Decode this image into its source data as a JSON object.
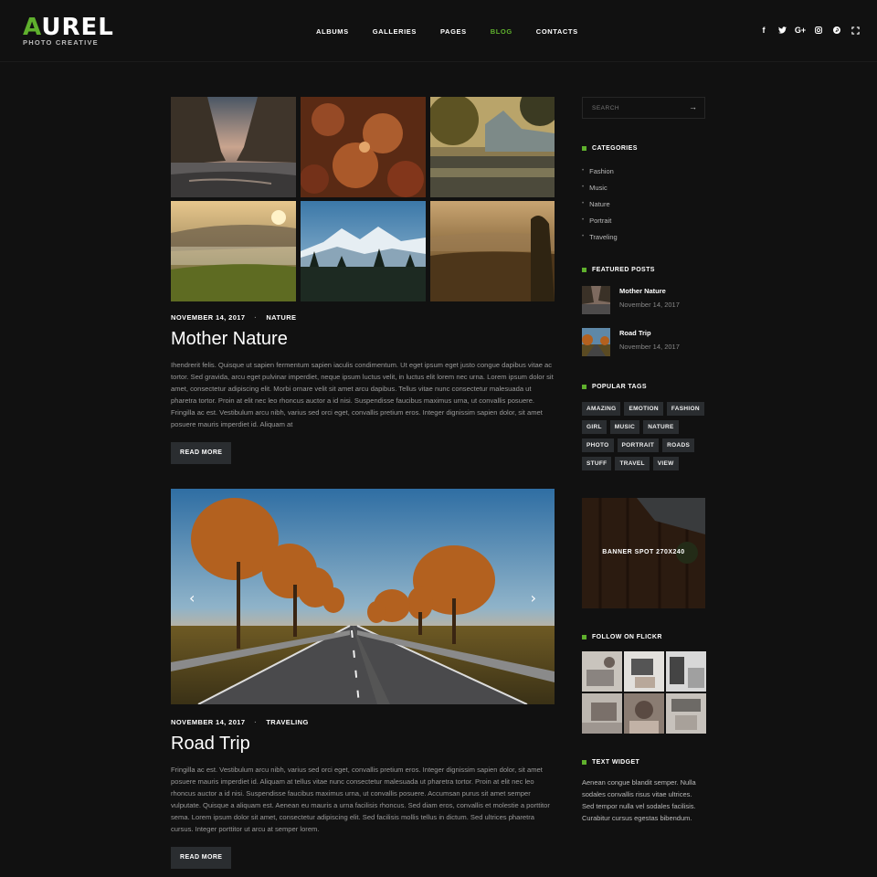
{
  "brand": {
    "logo_accent": "A",
    "logo_rest": "UREL",
    "tagline": "PHOTO CREATIVE",
    "accent_color": "#5fb02d"
  },
  "nav": {
    "items": [
      {
        "label": "ALBUMS"
      },
      {
        "label": "GALLERIES"
      },
      {
        "label": "PAGES"
      },
      {
        "label": "BLOG",
        "active": true
      },
      {
        "label": "CONTACTS"
      }
    ]
  },
  "social": [
    "facebook-icon",
    "twitter-icon",
    "google-plus-icon",
    "instagram-icon",
    "pinterest-icon",
    "fullscreen-icon"
  ],
  "social_labels": {
    "facebook": "f",
    "google": "G+"
  },
  "posts": [
    {
      "date": "NOVEMBER 14, 2017",
      "category": "NATURE",
      "title": "Mother Nature",
      "excerpt": "Ihendrerit felis. Quisque ut sapien fermentum sapien iaculis condimentum. Ut eget ipsum eget justo congue dapibus vitae ac tortor. Sed gravida, arcu eget pulvinar imperdiet, neque ipsum luctus velit, in luctus elit lorem nec urna. Lorem ipsum dolor sit amet, consectetur adipiscing elit. Morbi ornare velit sit amet arcu dapibus. Tellus vitae nunc consectetur malesuada ut pharetra tortor. Proin at elit nec leo rhoncus auctor a id nisi. Suspendisse faucibus maximus urna, ut convallis posuere. Fringilla ac est. Vestibulum arcu nibh, varius sed orci eget, convallis pretium eros. Integer dignissim sapien dolor, sit amet posuere mauris imperdiet id. Aliquam at",
      "button": "READ MORE"
    },
    {
      "date": "NOVEMBER 14, 2017",
      "category": "TRAVELING",
      "title": "Road Trip",
      "excerpt": "Fringilla ac est. Vestibulum arcu nibh, varius sed orci eget, convallis pretium eros. Integer dignissim sapien dolor, sit amet posuere mauris imperdiet id. Aliquam at tellus vitae nunc consectetur malesuada ut pharetra tortor. Proin at elit nec leo rhoncus auctor a id nisi. Suspendisse faucibus maximus urna, ut convallis posuere. Accumsan purus sit amet semper vulputate. Quisque a aliquam est. Aenean eu mauris a urna facilisis rhoncus. Sed diam eros, convallis et molestie a porttitor sema. Lorem ipsum dolor sit amet, consectetur adipiscing elit. Sed facilisis mollis tellus in dictum. Sed ultrices pharetra cursus. Integer porttitor ut arcu at semper lorem.",
      "button": "READ MORE"
    }
  ],
  "post_meta_separator": "·",
  "slider": {
    "prev": "‹",
    "next": "›"
  },
  "sidebar": {
    "search_placeholder": "SEARCH",
    "search_icon": "→",
    "categories_title": "CATEGORIES",
    "categories": [
      "Fashion",
      "Music",
      "Nature",
      "Portrait",
      "Traveling"
    ],
    "featured_title": "FEATURED POSTS",
    "featured": [
      {
        "title": "Mother Nature",
        "date": "November 14, 2017"
      },
      {
        "title": "Road Trip",
        "date": "November 14, 2017"
      }
    ],
    "tags_title": "POPULAR TAGS",
    "tags": [
      "AMAZING",
      "EMOTION",
      "FASHION",
      "GIRL",
      "MUSIC",
      "NATURE",
      "PHOTO",
      "PORTRAIT",
      "ROADS",
      "STUFF",
      "TRAVEL",
      "VIEW"
    ],
    "banner_text": "BANNER SPOT 270X240",
    "flickr_title": "FOLLOW ON FLICKR",
    "text_title": "TEXT WIDGET",
    "text_body": "Aenean congue blandit semper. Nulla sodales convallis risus vitae ultrices. Sed tempor nulla vel sodales facilisis. Curabitur cursus egestas bibendum."
  }
}
